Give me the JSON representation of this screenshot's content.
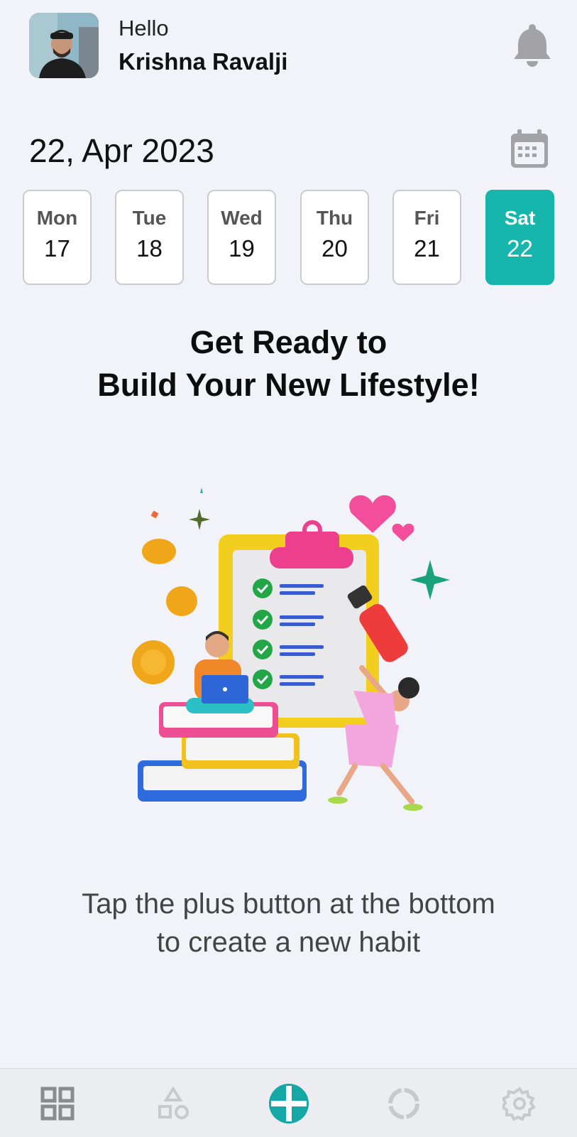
{
  "header": {
    "greeting": "Hello",
    "username": "Krishna Ravalji",
    "bell_icon": "bell-icon"
  },
  "date_bar": {
    "date": "22, Apr 2023",
    "calendar_icon": "calendar-icon"
  },
  "days": [
    {
      "name": "Mon",
      "num": "17",
      "active": false
    },
    {
      "name": "Tue",
      "num": "18",
      "active": false
    },
    {
      "name": "Wed",
      "num": "19",
      "active": false
    },
    {
      "name": "Thu",
      "num": "20",
      "active": false
    },
    {
      "name": "Fri",
      "num": "21",
      "active": false
    },
    {
      "name": "Sat",
      "num": "22",
      "active": true
    }
  ],
  "headline": {
    "line1": "Get Ready to",
    "line2": "Build Your New Lifestyle!"
  },
  "hint": {
    "line1": "Tap the plus button at the bottom",
    "line2": "to create a new habit"
  },
  "bottom_nav": {
    "items": [
      "grid-icon",
      "shapes-icon",
      "add-icon",
      "progress-icon",
      "settings-icon"
    ]
  },
  "colors": {
    "accent": "#17b6ad",
    "background": "#f2f3f9",
    "nav_background": "#ecedf1"
  }
}
